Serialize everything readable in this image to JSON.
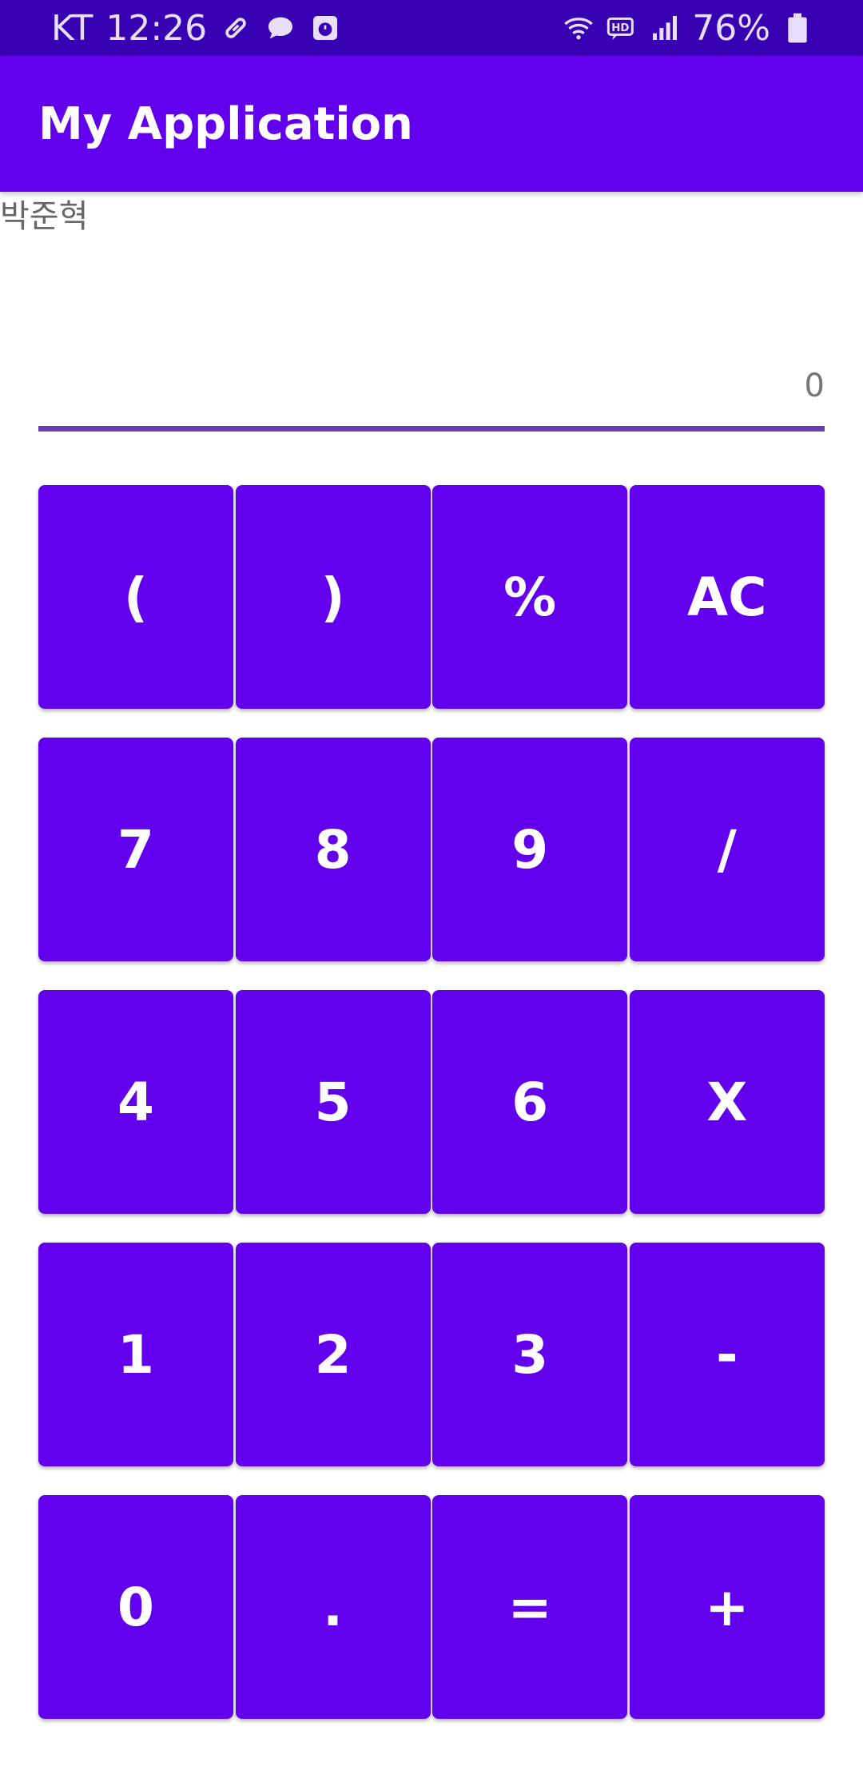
{
  "status_bar": {
    "carrier": "KT",
    "time": "12:26",
    "left_icons": [
      "pill-icon",
      "chat-bubble-icon",
      "alarm-app-icon"
    ],
    "right_icons": [
      "wifi-icon",
      "hd-voice-icon",
      "signal-icon"
    ],
    "battery_percent": "76%",
    "battery_level": 0.76
  },
  "app_bar": {
    "title": "My Application"
  },
  "name_label": "박준혁",
  "display": {
    "value": "0",
    "underline_color": "#673ab7"
  },
  "keypad": {
    "rows": [
      [
        "(",
        ")",
        "%",
        "AC"
      ],
      [
        "7",
        "8",
        "9",
        "/"
      ],
      [
        "4",
        "5",
        "6",
        "X"
      ],
      [
        "1",
        "2",
        "3",
        "-"
      ],
      [
        "0",
        ".",
        "=",
        "+"
      ]
    ]
  },
  "colors": {
    "status_bar": "#3700b3",
    "primary": "#6200ee",
    "key_text": "#ffffff"
  }
}
